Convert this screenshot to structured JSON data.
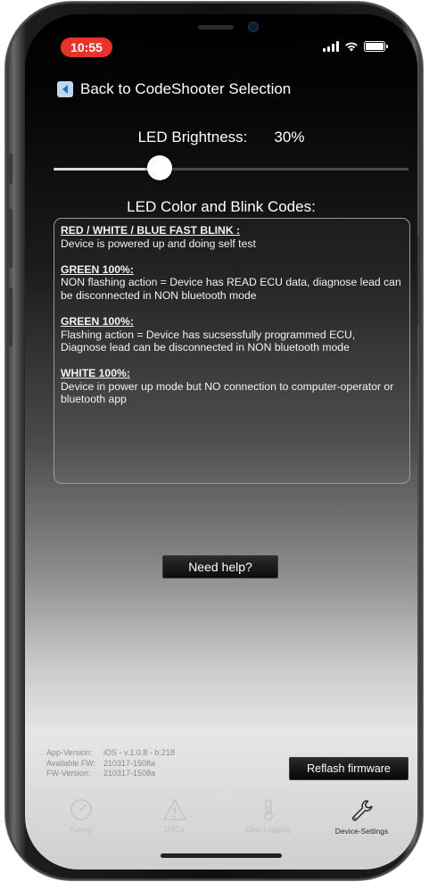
{
  "status_bar": {
    "time": "10:55"
  },
  "nav": {
    "back_label": "Back to CodeShooter Selection"
  },
  "brightness": {
    "label": "LED Brightness:",
    "value_text": "30%",
    "value": 0.3
  },
  "codes": {
    "title": "LED Color and Blink Codes:",
    "entries": [
      {
        "heading": "RED / WHITE / BLUE FAST BLINK :",
        "text": "Device is powered up and doing self test"
      },
      {
        "heading": "GREEN 100%:",
        "text": "NON flashing action = Device has READ ECU data, diagnose lead can be disconnected in NON bluetooth mode"
      },
      {
        "heading": "GREEN 100%:",
        "text": "Flashing action = Device has sucsessfully programmed ECU, Diagnose lead can be disconnected in NON bluetooth mode"
      },
      {
        "heading": "WHITE 100%:",
        "text": "Device in power up mode but NO connection to computer-operator or bluetooth app"
      }
    ]
  },
  "help_button": {
    "label": "Need help?"
  },
  "versions": {
    "app": {
      "label": "App-Version:",
      "value": "iOS - v.1.0.8 - b.218"
    },
    "available": {
      "label": "Available FW:",
      "value": "210317-1508a"
    },
    "fw": {
      "label": "FW-Version:",
      "value": "210317-1508a"
    }
  },
  "reflash_button": {
    "label": "Reflash firmware"
  },
  "tabs": [
    {
      "label": "Tuning",
      "icon": "gauge-icon"
    },
    {
      "label": "DTCs",
      "icon": "warning-icon"
    },
    {
      "label": "Data Logging",
      "icon": "thermometer-icon"
    },
    {
      "label": "Device-Settings",
      "icon": "wrench-icon",
      "active": true
    }
  ],
  "colors": {
    "time_pill": "#e8322c",
    "back_icon": "#bfd8f2"
  }
}
